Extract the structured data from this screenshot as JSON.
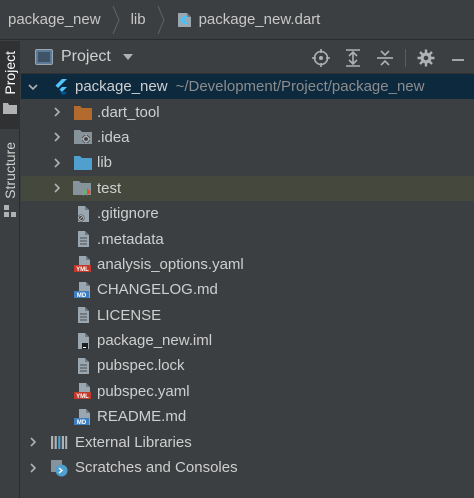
{
  "breadcrumb": {
    "items": [
      "package_new",
      "lib",
      "package_new.dart"
    ]
  },
  "side_stripe": {
    "project_label": "Project",
    "structure_label": "Structure"
  },
  "panel": {
    "title": "Project"
  },
  "tree": {
    "root": {
      "label": "package_new",
      "path": "~/Development/Project/package_new"
    },
    "items": [
      {
        "label": ".dart_tool",
        "icon": "folder-orange-icon",
        "expandable": true
      },
      {
        "label": ".idea",
        "icon": "folder-gear-icon",
        "expandable": true
      },
      {
        "label": "lib",
        "icon": "folder-blue-icon",
        "expandable": true
      },
      {
        "label": "test",
        "icon": "folder-test-icon",
        "expandable": true
      },
      {
        "label": ".gitignore",
        "icon": "ignore-file-icon",
        "expandable": false
      },
      {
        "label": ".metadata",
        "icon": "text-file-icon",
        "expandable": false
      },
      {
        "label": "analysis_options.yaml",
        "icon": "yaml-file-icon",
        "expandable": false
      },
      {
        "label": "CHANGELOG.md",
        "icon": "markdown-file-icon",
        "expandable": false
      },
      {
        "label": "LICENSE",
        "icon": "text-file-icon",
        "expandable": false
      },
      {
        "label": "package_new.iml",
        "icon": "iml-file-icon",
        "expandable": false
      },
      {
        "label": "pubspec.lock",
        "icon": "text-file-icon",
        "expandable": false
      },
      {
        "label": "pubspec.yaml",
        "icon": "yaml-file-icon",
        "expandable": false
      },
      {
        "label": "README.md",
        "icon": "markdown-file-icon",
        "expandable": false
      }
    ],
    "external_libraries": "External Libraries",
    "scratches": "Scratches and Consoles"
  },
  "colors": {
    "background": "#3c3f41",
    "selection": "#0d293e",
    "highlight": "#45493d",
    "text": "#cfcfcf",
    "path_hint": "#8c8c8c",
    "folder_blue": "#87939a",
    "folder_orange": "#b36a2d",
    "dart_blue": "#40c4ff"
  }
}
